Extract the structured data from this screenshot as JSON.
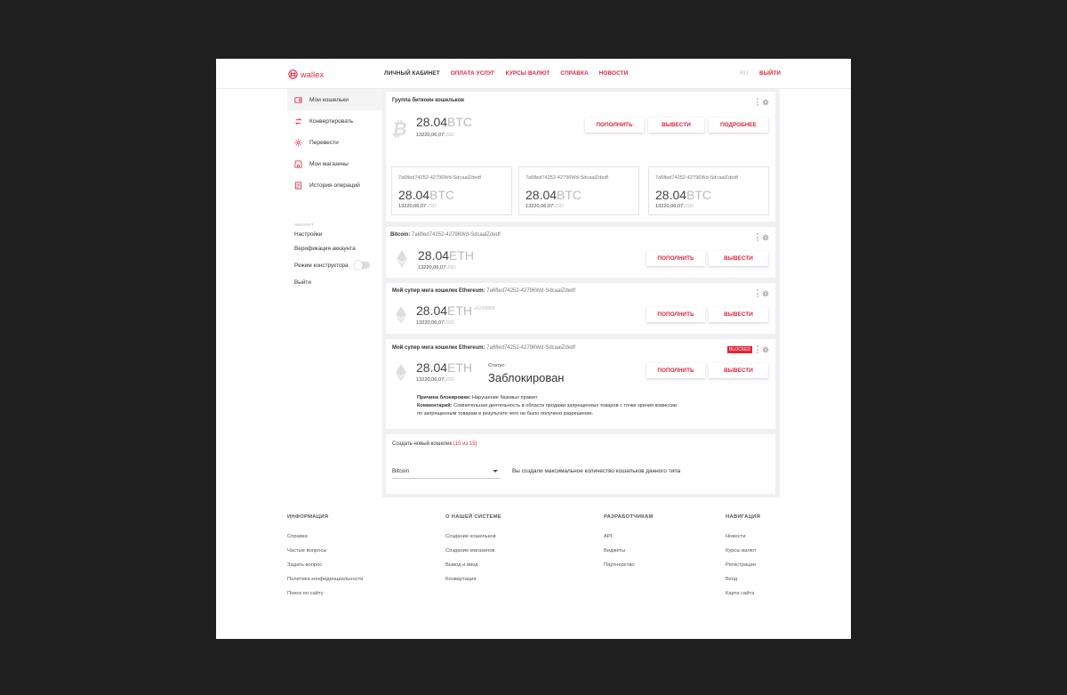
{
  "header": {
    "logo_text": "wallex",
    "nav": [
      {
        "label": "ЛИЧНЫЙ КАБИНЕТ",
        "style": "dark"
      },
      {
        "label": "ОПЛАТА УСЛУГ",
        "style": "red"
      },
      {
        "label": "КУРСЫ ВАЛЮТ",
        "style": "red"
      },
      {
        "label": "СПРАВКА",
        "style": "red"
      },
      {
        "label": "НОВОСТИ",
        "style": "red"
      }
    ],
    "lang": "RU",
    "logout": "ВЫЙТИ"
  },
  "sidebar": {
    "items": [
      {
        "label": "Мои кошельки",
        "icon": "wallet-icon",
        "active": true
      },
      {
        "label": "Конвертировать",
        "icon": "convert-icon"
      },
      {
        "label": "Перевести",
        "icon": "transfer-icon"
      },
      {
        "label": "Мои магазины",
        "icon": "store-icon"
      },
      {
        "label": "История операций",
        "icon": "history-icon"
      }
    ],
    "account_section": "аккаунт",
    "account_items": [
      "Настройки",
      "Верификация аккаунта",
      "Режим конструктора",
      "Выйти"
    ]
  },
  "group": {
    "title": "Группа биткоин кошельков",
    "amount": "28.04",
    "currency": "BTC",
    "usd_value": "13220,06,07",
    "usd_label": "USD",
    "buttons": [
      "ПОПОЛНИТЬ",
      "ВЫВЕСТИ",
      "ПОДРОБНЕЕ"
    ],
    "sub_wallets": [
      {
        "address": "7a6fled74252-42796Wd-SdcaalZdedf",
        "amount": "28.04",
        "currency": "BTC",
        "usd_value": "13220,06,07",
        "usd_label": "USD"
      },
      {
        "address": "7a6fled74252-42796Wd-SdcaalZdedf",
        "amount": "28.04",
        "currency": "BTC",
        "usd_value": "13220,06,07",
        "usd_label": "USD"
      },
      {
        "address": "7a6fled74252-42796Wd-SdcaalZdedf",
        "amount": "28.04",
        "currency": "BTC",
        "usd_value": "13220,06,07",
        "usd_label": "USD"
      }
    ]
  },
  "wallets": [
    {
      "title": "Bitcoin:",
      "address": "7a6fled74252-42796Wd-SdcaalZdedf",
      "amount": "28.04",
      "currency": "ETH",
      "delta": "",
      "usd_value": "13220,06,07",
      "usd_label": "USD",
      "buttons": [
        "ПОПОЛНИТЬ",
        "ВЫВЕСТИ"
      ]
    },
    {
      "title": "Мой супер мега кошелек Ethereum:",
      "address": "7a6fled74252-42796Wd-SdcaalZdedf",
      "amount": "28.04",
      "currency": "ETH",
      "delta": "+0,000004",
      "usd_value": "13220,06,07",
      "usd_label": "USD",
      "buttons": [
        "ПОПОЛНИТЬ",
        "ВЫВЕСТИ"
      ]
    }
  ],
  "blocked_wallet": {
    "title": "Мой супер мега кошелек Ethereum:",
    "address": "7a6fled74252-42796Wd-SdcaalZdedf",
    "badge": "BLOCKED",
    "amount": "28.04",
    "currency": "ETH",
    "usd_value": "13220,06,07",
    "usd_label": "USD",
    "status_label": "Статус:",
    "status_value": "Заблокирован",
    "reason_label": "Причина блокировки:",
    "reason_text": "Нарушение базовых правил",
    "comment_label": "Комментарий:",
    "comment_line1": "Сомнительная деятельность в области продажи запрещенных товаров с точки зрения комиссии",
    "comment_line2": "по запрещенным товарам в результате чего не было получено разрешение.",
    "buttons": [
      "ПОПОЛНИТЬ",
      "ВЫВЕСТИ"
    ]
  },
  "create": {
    "title": "Создать новый кошелек",
    "count": "(15 из 15)",
    "select_value": "Bitcoin",
    "message": "Вы создали максимальное количество кошельков данного типа"
  },
  "footer": {
    "columns": [
      {
        "heading": "ИНФОРМАЦИЯ",
        "links": [
          "Справка",
          "Частые вопросы",
          "Задать вопрос",
          "Политика конфиденциальности",
          "Поиск по сайту"
        ]
      },
      {
        "heading": "О НАШЕЙ СИСТЕМЕ",
        "links": [
          "Создание кошельков",
          "Создание магазинов",
          "Вывод и ввод",
          "Конвертация"
        ]
      },
      {
        "heading": "РАЗРАБОТЧИКАМ",
        "links": [
          "API",
          "Виджеты",
          "Партнерство"
        ]
      },
      {
        "heading": "НАВИГАЦИЯ",
        "links": [
          "Новости",
          "Курсы валют",
          "Регистрация",
          "Вход",
          "Карта сайта"
        ]
      }
    ]
  },
  "colors": {
    "accent": "#e0243a",
    "page_bg": "#1f1f1f",
    "main_bg": "#eef0f3"
  }
}
